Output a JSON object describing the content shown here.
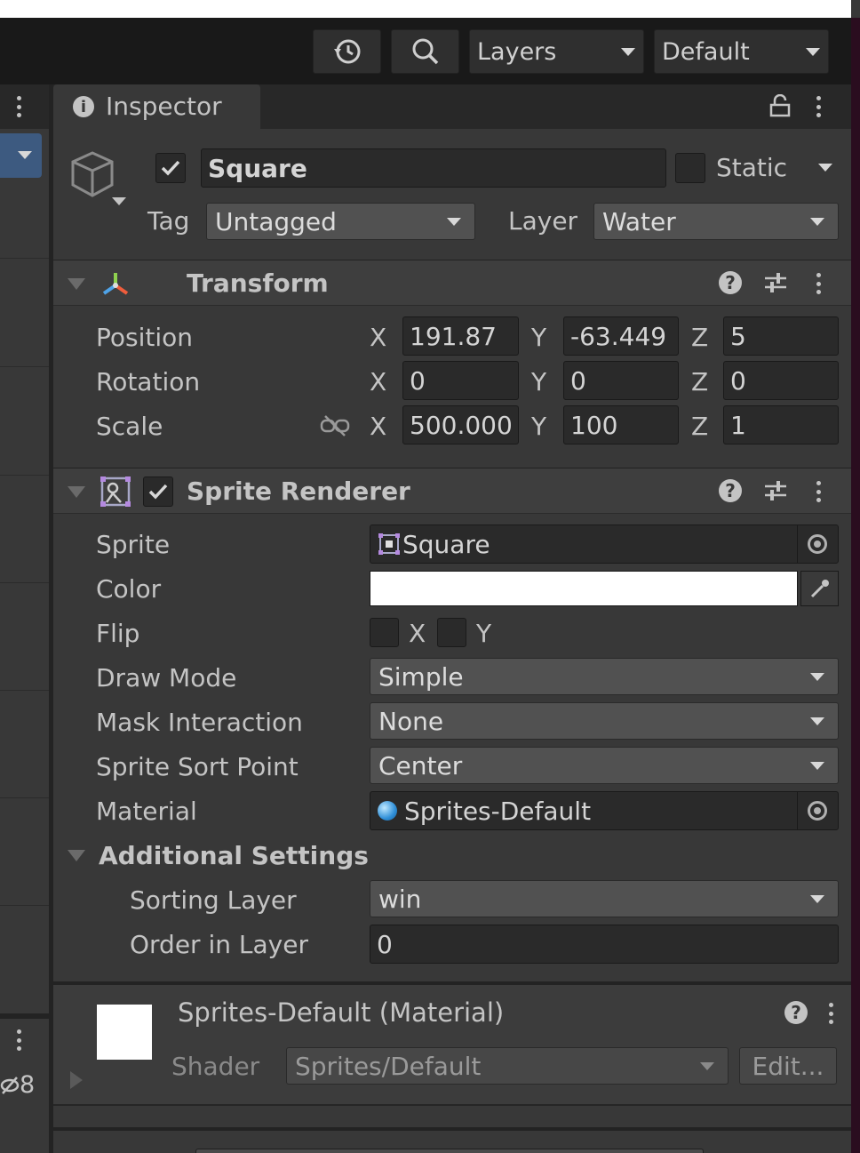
{
  "toolbar": {
    "layers_label": "Layers",
    "layout_label": "Default"
  },
  "inspector": {
    "tab_label": "Inspector",
    "object": {
      "name": "Square",
      "active": true,
      "static_label": "Static",
      "static": false,
      "tag_label": "Tag",
      "tag_value": "Untagged",
      "layer_label": "Layer",
      "layer_value": "Water"
    },
    "transform": {
      "title": "Transform",
      "position_label": "Position",
      "rotation_label": "Rotation",
      "scale_label": "Scale",
      "axis_x": "X",
      "axis_y": "Y",
      "axis_z": "Z",
      "position": {
        "x": "191.87",
        "y": "-63.449",
        "z": "5"
      },
      "rotation": {
        "x": "0",
        "y": "0",
        "z": "0"
      },
      "scale": {
        "x": "500.000",
        "y": "100",
        "z": "1"
      }
    },
    "sprite_renderer": {
      "title": "Sprite Renderer",
      "enabled": true,
      "sprite_label": "Sprite",
      "sprite_value": "Square",
      "color_label": "Color",
      "color_value": "#ffffff",
      "flip_label": "Flip",
      "flip_x": "X",
      "flip_y": "Y",
      "draw_mode_label": "Draw Mode",
      "draw_mode_value": "Simple",
      "mask_label": "Mask Interaction",
      "mask_value": "None",
      "sort_point_label": "Sprite Sort Point",
      "sort_point_value": "Center",
      "material_label": "Material",
      "material_value": "Sprites-Default",
      "additional_label": "Additional Settings",
      "sorting_layer_label": "Sorting Layer",
      "sorting_layer_value": "win",
      "order_label": "Order in Layer",
      "order_value": "0"
    },
    "material": {
      "title": "Sprites-Default (Material)",
      "shader_label": "Shader",
      "shader_value": "Sprites/Default",
      "edit_label": "Edit..."
    }
  },
  "left_panel": {
    "count": "8"
  },
  "colors": {
    "panel_bg": "#383838",
    "toolbar_bg": "#191919",
    "field_bg": "#2a2a2a",
    "dropdown_bg": "#515151",
    "accent_blue": "#3d5a80"
  }
}
